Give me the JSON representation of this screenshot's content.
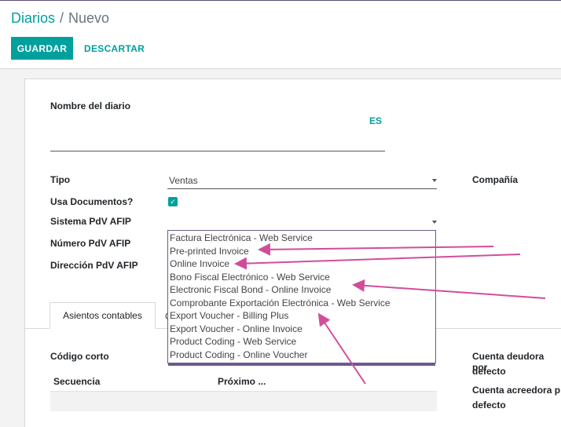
{
  "breadcrumb": {
    "parent": "Diarios",
    "separator": "/",
    "current": "Nuevo"
  },
  "toolbar": {
    "save_label": "GUARDAR",
    "discard_label": "DESCARTAR"
  },
  "form": {
    "journal_name_label": "Nombre del diario",
    "language_code": "ES",
    "type_label": "Tipo",
    "type_value": "Ventas",
    "uses_documents_label": "Usa Documentos?",
    "pos_system_label": "Sistema PdV AFIP",
    "pos_number_label": "Número PdV AFIP",
    "pos_address_label": "Dirección PdV AFIP",
    "company_label": "Compañía",
    "short_code_label": "Código corto",
    "debit_account_label_line1": "Cuenta deudora por",
    "debit_account_label_line2": "defecto",
    "credit_account_label_line1": "Cuenta acreedora p",
    "credit_account_label_line2": "defecto"
  },
  "tabs": [
    {
      "label": "Asientos contables"
    },
    {
      "label": "C"
    }
  ],
  "sequence_table": {
    "columns": [
      "Secuencia",
      "Próximo ..."
    ]
  },
  "dropdown": {
    "options": [
      "Factura Electrónica - Web Service",
      "Pre-printed Invoice",
      "Online Invoice",
      "Bono Fiscal Electrónico - Web Service",
      "Electronic Fiscal Bond - Online Invoice",
      "Comprobante Exportación Electrónica - Web Service",
      "Export Voucher - Billing Plus",
      "Export Voucher - Online Invoice",
      "Product Coding - Web Service",
      "Product Coding - Online Voucher"
    ]
  },
  "colors": {
    "accent": "#00a09d",
    "annotation_arrow": "#d14d9b",
    "dropdown_border": "#6d5a8a"
  },
  "icons": {
    "checkbox": "check-icon",
    "select_caret": "caret-down-icon",
    "annotation": "arrow-icon"
  }
}
